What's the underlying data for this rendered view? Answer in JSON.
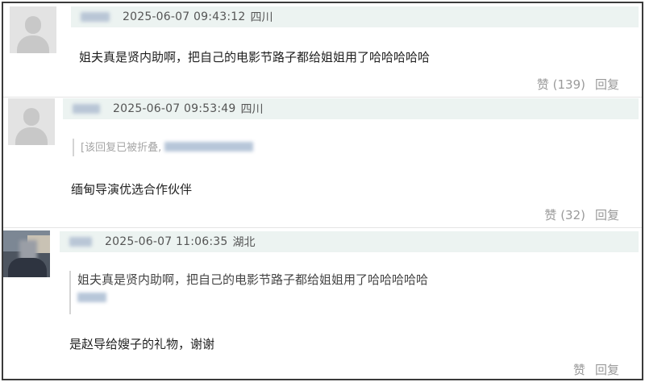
{
  "comments": [
    {
      "time": "2025-06-07 09:43:12",
      "location": "四川",
      "text": "姐夫真是贤内助啊，把自己的电影节路子都给姐姐用了哈哈哈哈哈",
      "like_label": "赞 (139)",
      "reply_label": "回复"
    },
    {
      "time": "2025-06-07 09:53:49",
      "location": "四川",
      "quote": "[该回复已被折叠,",
      "text": "缅甸导演优选合作伙伴",
      "like_label": "赞 (32)",
      "reply_label": "回复"
    },
    {
      "time": "2025-06-07 11:06:35",
      "location": "湖北",
      "quote": "姐夫真是贤内助啊，把自己的电影节路子都给姐姐用了哈哈哈哈哈",
      "text": "是赵导给嫂子的礼物，谢谢",
      "like_label": "赞",
      "reply_label": "回复"
    }
  ]
}
